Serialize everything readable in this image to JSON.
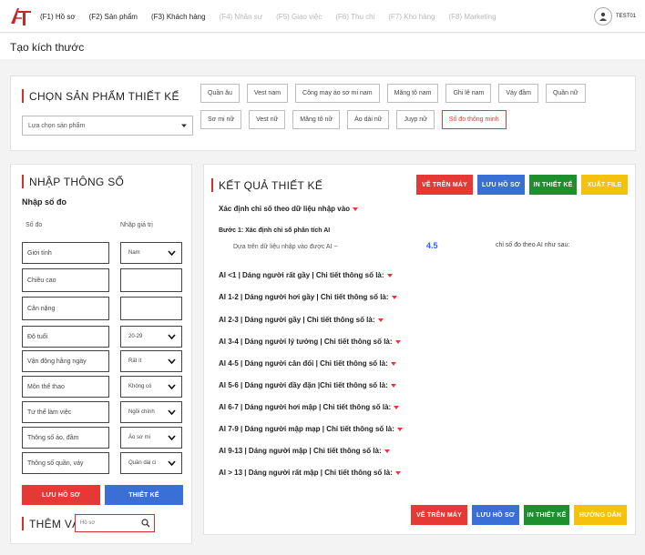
{
  "user": {
    "name": "TEST01",
    "icon": "user-icon"
  },
  "nav": [
    {
      "label": "(F1) Hồ sơ",
      "active": true
    },
    {
      "label": "(F2) Sản phẩm",
      "active": true
    },
    {
      "label": "(F3) Khách hàng",
      "active": true
    },
    {
      "label": "(F4) Nhân sự",
      "active": false
    },
    {
      "label": "(F5) Giao việc",
      "active": false
    },
    {
      "label": "(F6) Thu chi",
      "active": false
    },
    {
      "label": "(F7) Kho hàng",
      "active": false
    },
    {
      "label": "(F8) Marketing",
      "active": false
    }
  ],
  "page_title": "Tạo kích thước",
  "product_panel": {
    "title": "CHỌN SẢN PHẨM THIẾT KẾ",
    "select_placeholder": "Lựa chọn sản phẩm",
    "chips": [
      {
        "label": "Quần âu",
        "active": false
      },
      {
        "label": "Vest nam",
        "active": false
      },
      {
        "label": "Công may áo sơ mi nam",
        "active": false
      },
      {
        "label": "Măng tô nam",
        "active": false
      },
      {
        "label": "Ghi lê nam",
        "active": false
      },
      {
        "label": "Váy đầm",
        "active": false
      },
      {
        "label": "Quần nữ",
        "active": false
      },
      {
        "label": "Sơ mi nữ",
        "active": false
      },
      {
        "label": "Vest nữ",
        "active": false
      },
      {
        "label": "Măng tô nữ",
        "active": false
      },
      {
        "label": "Áo dài nữ",
        "active": false
      },
      {
        "label": "Juyp nữ",
        "active": false
      },
      {
        "label": "Số đo thông minh",
        "active": true
      }
    ]
  },
  "input_panel": {
    "title": "NHẬP THÔNG SỐ",
    "subtitle": "Nhập số đo",
    "col_measure": "Số đo",
    "col_value": "Nhập giá trị",
    "fields": [
      {
        "label": "Giới tính",
        "value": "Nam",
        "dropdown": true
      },
      {
        "label": "Chiều cao",
        "value": "",
        "dropdown": false
      },
      {
        "label": "Cân nặng",
        "value": "",
        "dropdown": false
      },
      {
        "label": "Độ tuổi",
        "value": "20-29",
        "dropdown": true
      },
      {
        "label": "Vận động hằng ngày",
        "value": "Rất ít",
        "dropdown": true
      },
      {
        "label": "Môn thể thao",
        "value": "Không có",
        "dropdown": true
      },
      {
        "label": "Tư thế làm việc",
        "value": "Ngồi chính",
        "dropdown": true
      },
      {
        "label": "Thông số áo, đầm",
        "value": "Áo sơ mi",
        "dropdown": true
      },
      {
        "label": "Thông số quần, váy",
        "value": "Quần dài ci",
        "dropdown": true
      }
    ],
    "save_button": "LƯU HỒ SƠ",
    "design_button": "THIẾT KẾ",
    "add_title": "THÊM VÀO",
    "add_placeholder": "Hồ sơ"
  },
  "result_panel": {
    "title": "KẾT QUẢ THIẾT KẾ",
    "top_buttons": [
      "VẼ TRÊN MÁY",
      "LƯU HỒ SƠ",
      "IN THIẾT KẾ",
      "XUẤT FILE"
    ],
    "heading": "Xác định chỉ số theo dữ liệu nhập vào",
    "step": "Bước 1: Xác định chỉ số phân tích AI",
    "ai_text": "Dựa trên dữ liệu nhập vào được AI ~",
    "ai_value": "4.5",
    "ai_note": "chỉ số đo theo AI như sau:",
    "ranges": [
      "AI <1 | Dáng người rất gầy | Chi tiết thông số là:",
      "AI 1-2 | Dáng người hơi gầy | Chi tiết thông số là:",
      "AI 2-3 | Dáng người gầy | Chi tiết thông số là:",
      "AI 3-4 | Dáng người lý tưởng | Chi tiết thông số là:",
      "AI 4-5 | Dáng người cân đối | Chi tiết thông số là:",
      "AI 5-6 | Dáng người đầy đặn |Chi tiết thông số là:",
      "AI 6-7 | Dáng người hơi mập | Chi tiết thông số là:",
      "AI 7-9 | Dáng người mập mạp | Chi tiết thông số là:",
      "AI 9-13 | Dáng người mập | Chi tiết thông số là:",
      "AI > 13 | Dáng người rất mập | Chi tiết thông số là:"
    ],
    "bottom_buttons": [
      "VẼ TRÊN MÁY",
      "LƯU HỒ SƠ",
      "IN THIẾT KẾ",
      "HƯỚNG DẪN"
    ]
  },
  "colors": {
    "accent_red": "#e53935",
    "blue": "#3a6fd6",
    "green": "#1e8e2f",
    "yellow": "#f4c20d",
    "ai_value": "#2962ff"
  }
}
